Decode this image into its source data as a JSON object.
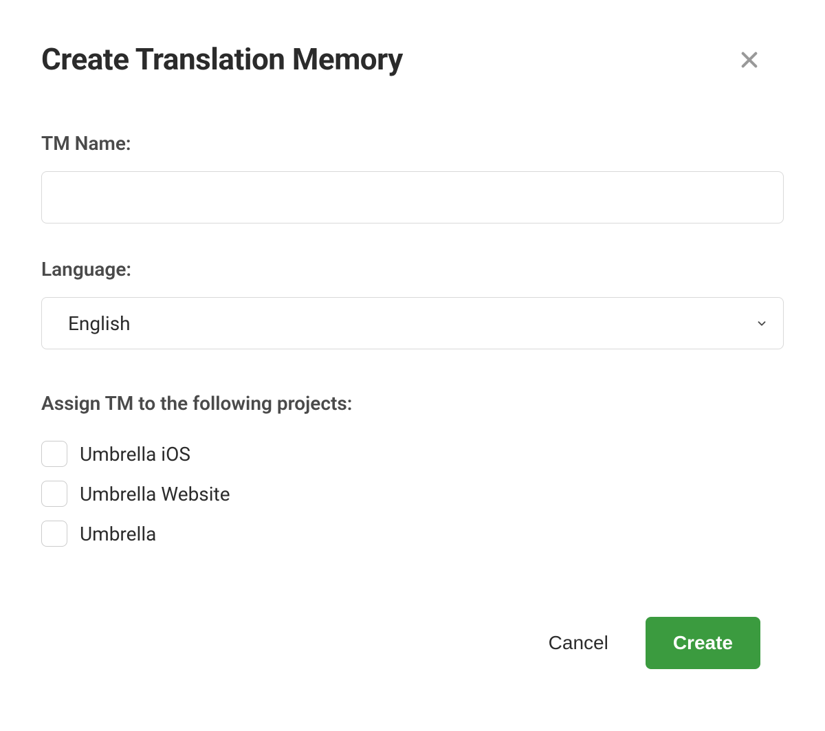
{
  "modal": {
    "title": "Create Translation Memory",
    "close_icon": "close"
  },
  "form": {
    "tm_name_label": "TM Name:",
    "tm_name_value": "",
    "language_label": "Language:",
    "language_selected": "English"
  },
  "projects": {
    "label": "Assign TM to the following projects:",
    "items": [
      {
        "label": "Umbrella iOS",
        "checked": false
      },
      {
        "label": "Umbrella Website",
        "checked": false
      },
      {
        "label": "Umbrella",
        "checked": false
      }
    ]
  },
  "footer": {
    "cancel_label": "Cancel",
    "create_label": "Create"
  }
}
